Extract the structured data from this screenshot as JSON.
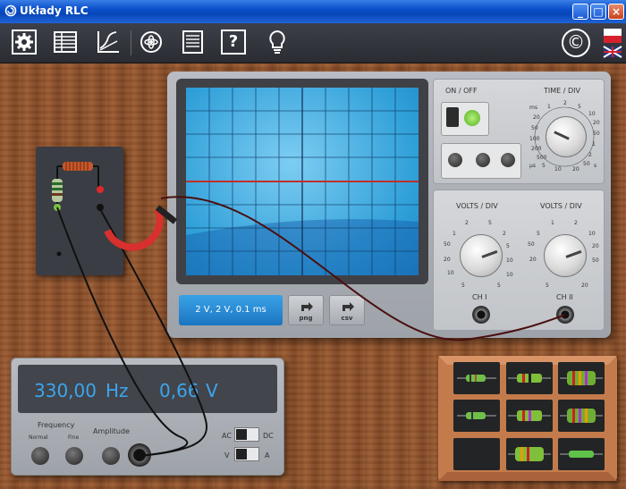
{
  "window": {
    "title": "Układy RLC",
    "buttons": {
      "minimize": "_",
      "maximize": "□",
      "close": "×"
    }
  },
  "toolbar": {
    "icons": [
      "gear-icon",
      "table-icon",
      "graph-icon",
      "atom-icon",
      "document-icon",
      "help-icon",
      "bulb-icon",
      "copyright-icon",
      "flag-icon"
    ],
    "help_label": "?",
    "copyright_label": "©"
  },
  "oscilloscope": {
    "readout": "2 V, 2 V, 0.1 ms",
    "export_png": "png",
    "export_csv": "csv",
    "on_off_label": "ON / OFF",
    "time_div_label": "TIME / DIV",
    "time_scale": {
      "unit_ms": "ms",
      "unit_us": "µs",
      "unit_s": "s",
      "ticks": [
        "20",
        "50",
        "100",
        "200",
        "500",
        "1",
        "2",
        "5",
        "10",
        "20",
        "50",
        "1",
        "2",
        "5",
        "10",
        "20",
        "50"
      ]
    },
    "volts_div_label_1": "VOLTS / DIV",
    "volts_div_label_2": "VOLTS / DIV",
    "volts_ticks": [
      "2",
      "5",
      "1",
      "2",
      "5",
      "10",
      "20",
      "50",
      "5",
      "1",
      "2",
      "5",
      "10",
      "20",
      "50"
    ],
    "ch1": "CH I",
    "ch2": "CH II"
  },
  "meter": {
    "frequency_value": "330,00",
    "frequency_unit": "Hz",
    "voltage_value": "0,66",
    "voltage_unit": "V",
    "frequency_label": "Frequency",
    "normal_label": "Normal",
    "fine_label": "Fine",
    "amplitude_label": "Amplitude",
    "ac_label": "AC",
    "dc_label": "DC",
    "v_label": "V",
    "a_label": "A"
  },
  "colors": {
    "screen": "#2f9fd8",
    "readout": "#1b75c1",
    "display_text": "#3ba6ee",
    "trace": "#c0302a"
  }
}
